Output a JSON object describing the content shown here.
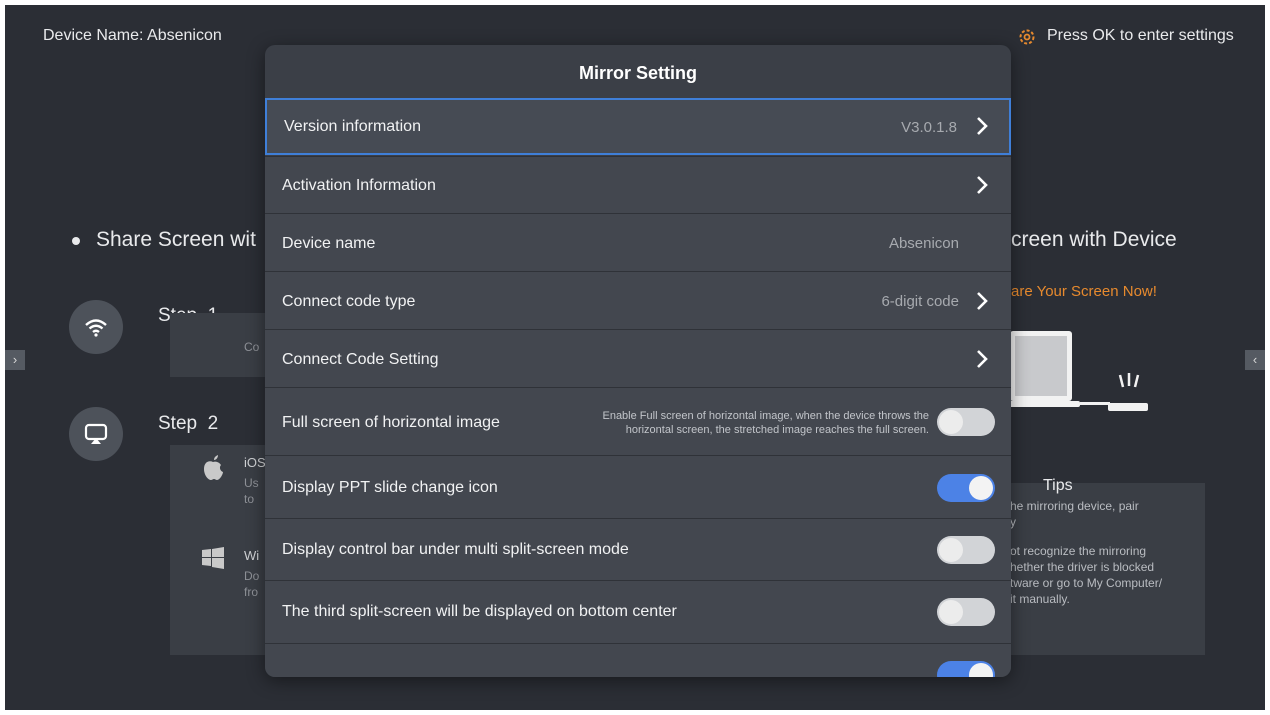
{
  "background": {
    "device_name": "Device Name: Absenicon",
    "settings_hint": "Press OK to enter settings",
    "left_heading": "Share Screen wit",
    "right_heading": "creen with Device",
    "share_now": "are Your Screen Now!",
    "step1_label": "Step",
    "step1_num": "1",
    "step1_card_text": "Co",
    "step2_label": "Step",
    "step2_num": "2",
    "ios_title": "iOS",
    "ios_line1": "Us",
    "ios_line2": "to",
    "win_title": "Wi",
    "win_line1": "Do",
    "win_line2": "fro",
    "tips_title": "Tips",
    "tips_line1": "he mirroring device, pair",
    "tips_line2": "y",
    "tips_line3": "ot recognize the mirroring",
    "tips_line4": "hether the driver is blocked",
    "tips_line5": "tware or go to My Computer/",
    "tips_line6": "it manually.",
    "left_edge_arrow": "›",
    "right_edge_arrow": "‹"
  },
  "modal": {
    "title": "Mirror Setting",
    "rows": [
      {
        "label": "Version information",
        "value": "V3.0.1.8"
      },
      {
        "label": "Activation Information",
        "value": ""
      },
      {
        "label": "Device name",
        "value": "Absenicon"
      },
      {
        "label": "Connect code type",
        "value": "6-digit code"
      },
      {
        "label": "Connect Code Setting",
        "value": ""
      },
      {
        "label": "Full screen of horizontal image",
        "description_line1": "Enable Full screen of horizontal image, when the device throws the",
        "description_line2": "horizontal screen, the stretched image reaches the full screen.",
        "toggle": "off"
      },
      {
        "label": "Display PPT slide change icon",
        "toggle": "on"
      },
      {
        "label": "Display control bar under multi split-screen mode",
        "toggle": "off"
      },
      {
        "label": "The third split-screen will be displayed on bottom center",
        "toggle": "off"
      },
      {
        "label": "",
        "toggle": "on"
      }
    ]
  },
  "colors": {
    "accent_blue": "#4c82e6",
    "focus_border": "#3f7fd8",
    "orange": "#e78a2e",
    "background": "#2b2e35"
  },
  "icons": [
    "gear-icon",
    "wifi-icon",
    "airplay-icon",
    "apple-icon",
    "windows-icon",
    "chevron-right-icon",
    "laptop-icon",
    "dongle-icon"
  ]
}
